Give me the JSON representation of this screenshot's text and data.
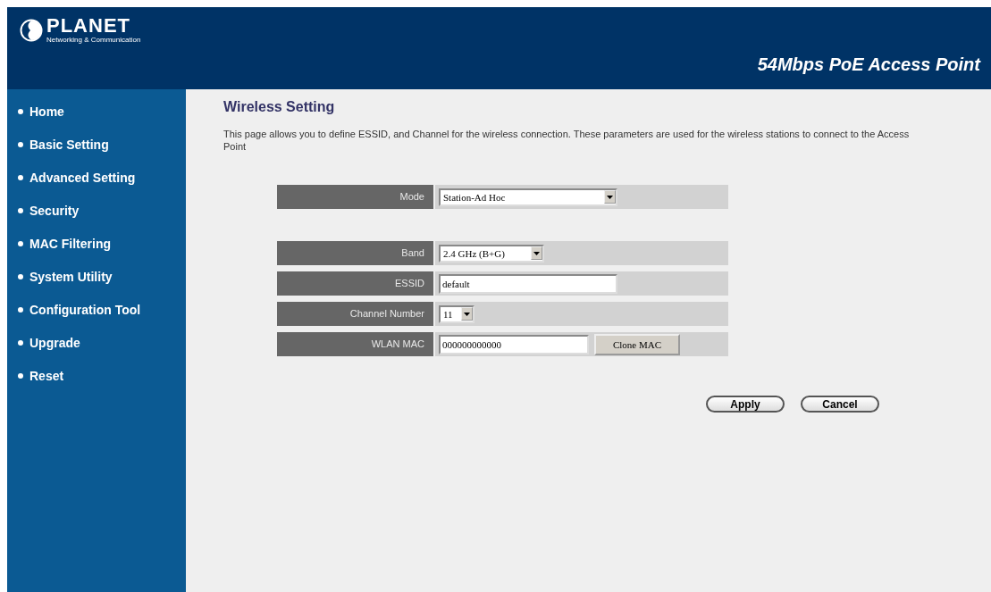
{
  "logo": {
    "name": "PLANET",
    "tagline": "Networking & Communication"
  },
  "header": {
    "title": "54Mbps PoE Access Point"
  },
  "sidebar": {
    "items": [
      {
        "label": "Home"
      },
      {
        "label": "Basic Setting"
      },
      {
        "label": "Advanced Setting"
      },
      {
        "label": "Security"
      },
      {
        "label": "MAC Filtering"
      },
      {
        "label": "System Utility"
      },
      {
        "label": "Configuration Tool"
      },
      {
        "label": "Upgrade"
      },
      {
        "label": "Reset"
      }
    ]
  },
  "page": {
    "title": "Wireless Setting",
    "description": "This page allows you to define ESSID, and Channel for the wireless connection. These parameters are used for the wireless stations to connect to the Access Point"
  },
  "form": [
    {
      "kind": "select",
      "label": "Mode",
      "value": "Station-Ad Hoc"
    },
    {
      "kind": "spacer"
    },
    {
      "kind": "select",
      "label": "Band",
      "value": "2.4 GHz (B+G)"
    },
    {
      "kind": "text",
      "label": "ESSID",
      "value": "default"
    },
    {
      "kind": "select",
      "label": "Channel Number",
      "value": "11"
    },
    {
      "kind": "text-button",
      "label": "WLAN MAC",
      "value": "000000000000",
      "button": "Clone MAC"
    }
  ],
  "buttons": [
    "Apply",
    "Cancel"
  ]
}
